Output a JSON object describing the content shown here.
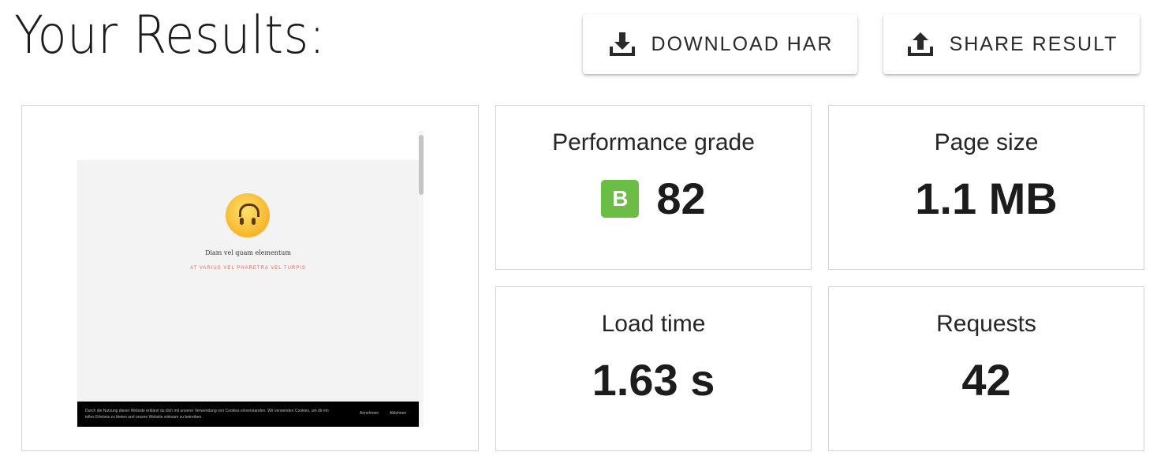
{
  "page": {
    "title": "Your Results:"
  },
  "actions": {
    "download_label": "DOWNLOAD HAR",
    "share_label": "SHARE RESULT"
  },
  "preview": {
    "heading": "Diam vel quam elementum",
    "subheading": "AT VARIUS VEL PHARETRA VEL TURPIS",
    "cookie_text": "Durch die Nutzung dieser Website erklärst du dich mit unserer Verwendung von Cookies einverstanden. Wir verwenden Cookies, um dir ein tolles Erlebnis zu bieten und unsere Website wirksam zu betreiben.",
    "cookie_accept": "Annehmen",
    "cookie_decline": "Ablehnen"
  },
  "metrics": {
    "performance": {
      "label": "Performance grade",
      "grade": "B",
      "score": "82",
      "grade_color": "#6cbd45"
    },
    "page_size": {
      "label": "Page size",
      "value": "1.1 MB"
    },
    "load_time": {
      "label": "Load time",
      "value": "1.63 s"
    },
    "requests": {
      "label": "Requests",
      "value": "42"
    }
  },
  "icons": {
    "download": "download-icon",
    "share": "share-icon"
  }
}
